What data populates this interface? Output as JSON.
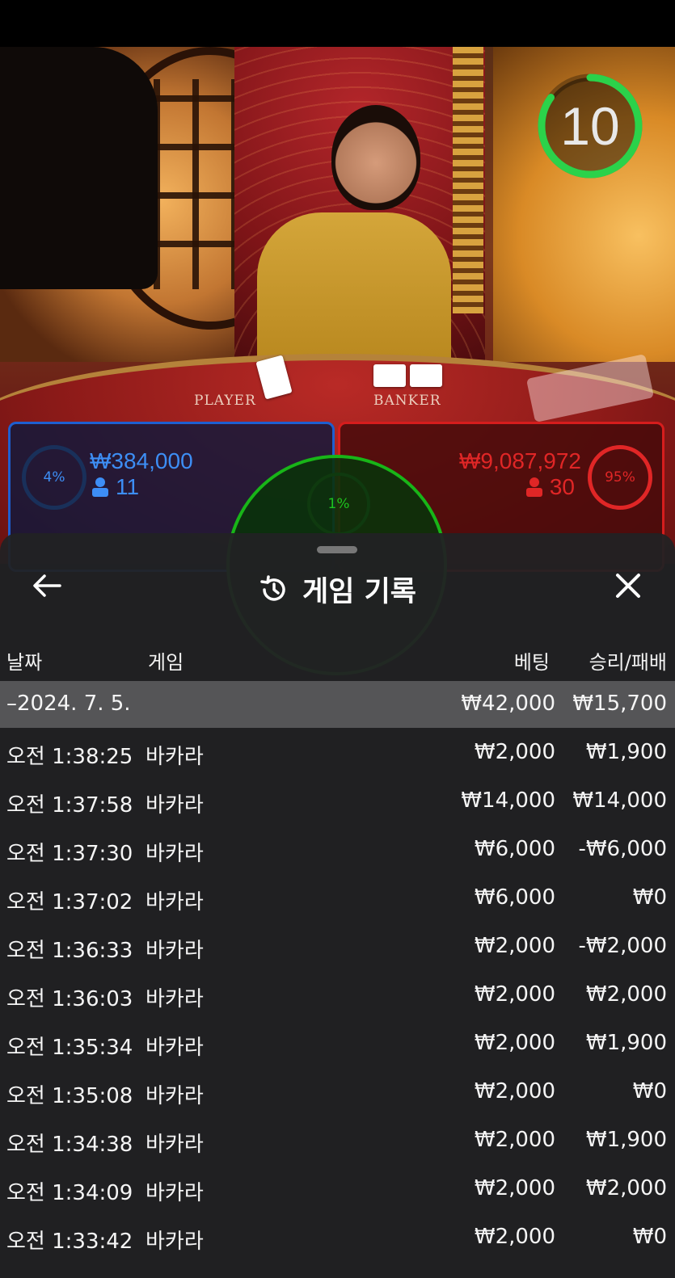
{
  "timer": {
    "value": "10",
    "progress": 0.85
  },
  "table": {
    "player_label": "PLAYER",
    "banker_label": "BANKER"
  },
  "bets": {
    "player": {
      "percent": "4%",
      "amount": "₩384,000",
      "players": "11",
      "color": "#1e5fd0"
    },
    "banker": {
      "percent": "95%",
      "amount": "₩9,087,972",
      "players": "30",
      "color": "#d61d1d"
    },
    "tie": {
      "percent": "1%",
      "color": "#18b518"
    }
  },
  "history": {
    "title": "게임 기록",
    "columns": {
      "date": "날짜",
      "game": "게임",
      "bet": "베팅",
      "win_loss": "승리/패배"
    },
    "date_group": {
      "date": "–2024. 7. 5.",
      "bet": "₩42,000",
      "win_loss": "₩15,700"
    },
    "rows": [
      {
        "time": "오전 1:38:25",
        "game": "바카라",
        "bet": "₩2,000",
        "win_loss": "₩1,900"
      },
      {
        "time": "오전 1:37:58",
        "game": "바카라",
        "bet": "₩14,000",
        "win_loss": "₩14,000"
      },
      {
        "time": "오전 1:37:30",
        "game": "바카라",
        "bet": "₩6,000",
        "win_loss": "-₩6,000"
      },
      {
        "time": "오전 1:37:02",
        "game": "바카라",
        "bet": "₩6,000",
        "win_loss": "₩0"
      },
      {
        "time": "오전 1:36:33",
        "game": "바카라",
        "bet": "₩2,000",
        "win_loss": "-₩2,000"
      },
      {
        "time": "오전 1:36:03",
        "game": "바카라",
        "bet": "₩2,000",
        "win_loss": "₩2,000"
      },
      {
        "time": "오전 1:35:34",
        "game": "바카라",
        "bet": "₩2,000",
        "win_loss": "₩1,900"
      },
      {
        "time": "오전 1:35:08",
        "game": "바카라",
        "bet": "₩2,000",
        "win_loss": "₩0"
      },
      {
        "time": "오전 1:34:38",
        "game": "바카라",
        "bet": "₩2,000",
        "win_loss": "₩1,900"
      },
      {
        "time": "오전 1:34:09",
        "game": "바카라",
        "bet": "₩2,000",
        "win_loss": "₩2,000"
      },
      {
        "time": "오전 1:33:42",
        "game": "바카라",
        "bet": "₩2,000",
        "win_loss": "₩0"
      }
    ]
  },
  "icons": {
    "back": "arrow-left-icon",
    "history": "history-icon",
    "close": "close-icon",
    "user": "user-icon"
  }
}
